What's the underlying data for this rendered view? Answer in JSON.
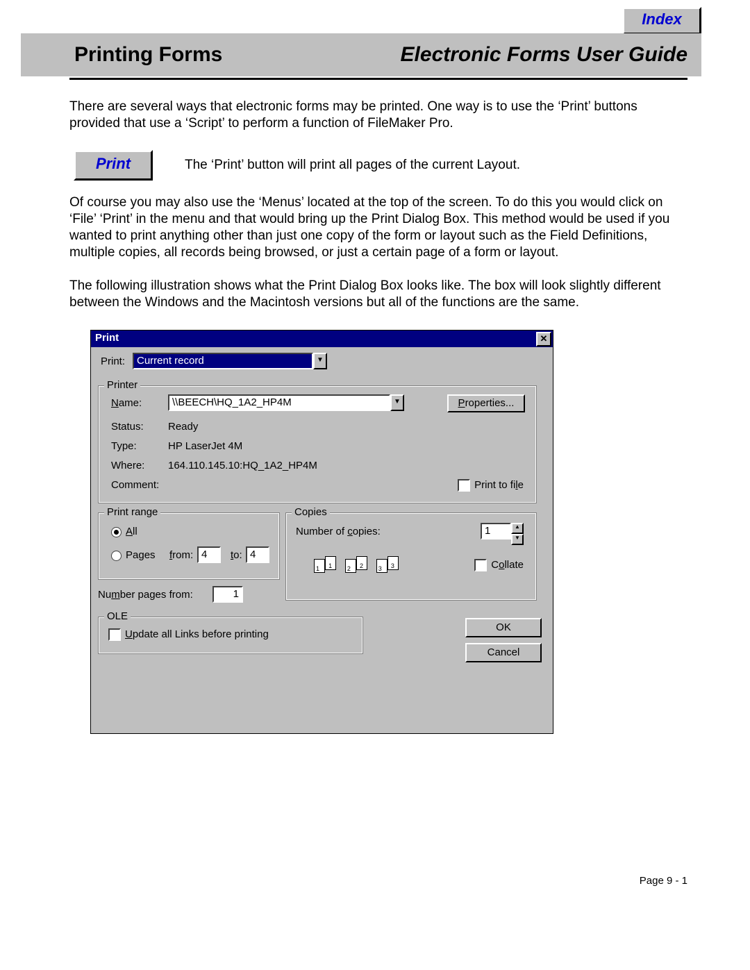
{
  "index_button": "Index",
  "header": {
    "left": "Printing Forms",
    "right": "Electronic Forms User Guide"
  },
  "para1": "There are several ways that electronic forms may be printed. One way is to use the ‘Print’ buttons provided that use a ‘Script’ to perform a function of FileMaker Pro.",
  "print_button": "Print",
  "print_button_desc": "The ‘Print’ button will print all pages of the current Layout.",
  "para2": "Of course you may also use the ‘Menus’ located at the top of the screen. To do this you would click on ‘File’ ‘Print’ in the menu and that would bring up the Print Dialog Box. This method would be used if you wanted to print anything other than just one copy of the form or layout such as the Field Definitions, multiple copies, all records being browsed, or just a certain page of a form or layout.",
  "para3": "The following illustration shows what the Print Dialog Box looks like. The box will look slightly different between the Windows and the Macintosh versions but all of the functions are the same.",
  "dialog": {
    "title": "Print",
    "print_label": "Print:",
    "print_scope": "Current record",
    "printer_group": "Printer",
    "name_label": "Name:",
    "name_value": "\\\\BEECH\\HQ_1A2_HP4M",
    "properties": "Properties...",
    "status_label": "Status:",
    "status_value": "Ready",
    "type_label": "Type:",
    "type_value": "HP LaserJet 4M",
    "where_label": "Where:",
    "where_value": "164.110.145.10:HQ_1A2_HP4M",
    "comment_label": "Comment:",
    "print_to_file": "Print to file",
    "range_group": "Print range",
    "all_option": "All",
    "pages_option": "Pages",
    "from_label": "from:",
    "from_value": "4",
    "to_label": "to:",
    "to_value": "4",
    "number_pages_from_label": "Number pages from:",
    "number_pages_from_value": "1",
    "copies_group": "Copies",
    "number_of_copies_label": "Number of copies:",
    "number_of_copies_value": "1",
    "collate_label": "Collate",
    "ole_group": "OLE",
    "update_links": "Update all Links before printing",
    "ok": "OK",
    "cancel": "Cancel"
  },
  "footer": "Page  9 - 1"
}
